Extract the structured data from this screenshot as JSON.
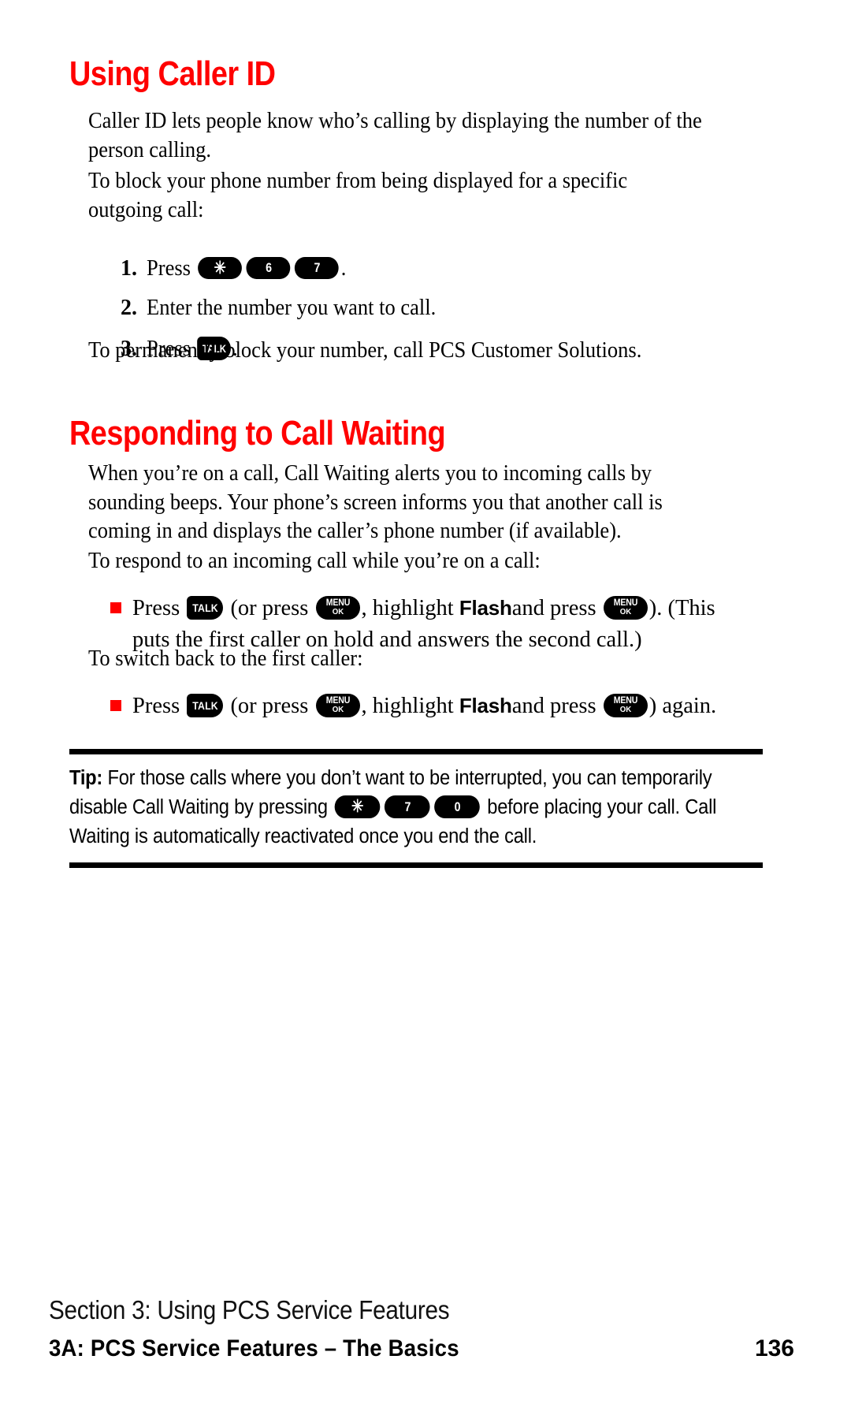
{
  "page": {
    "background_color": "#ffffff",
    "accent_color": "#ff0000",
    "text_color": "#000000"
  },
  "headings": {
    "caller_id": "Using Caller ID",
    "call_waiting": "Responding to Call Waiting"
  },
  "paragraphs": {
    "caller_id_intro": "Caller ID lets people know who’s calling by displaying the number of the person calling.",
    "block_intro": "To block your phone number from being displayed for a specific outgoing call:",
    "permanently_block": "To permanently block your number, call PCS Customer Solutions.",
    "call_waiting_intro": "When you’re on a call, Call Waiting alerts you to incoming calls by sounding beeps. Your phone’s screen informs you that another call is coming in and displays the caller’s phone number (if available).",
    "respond_intro": "To respond to an incoming call while you’re on a call:",
    "switch_back_intro": "To switch back to the first caller:"
  },
  "steps": [
    {
      "number": "1.",
      "before_keys": "Press",
      "keys": [
        "star",
        "6",
        "7"
      ],
      "after_keys": "."
    },
    {
      "number": "2.",
      "text": "Enter the number you want to call."
    },
    {
      "number": "3.",
      "before_keys": "Press",
      "keys": [
        "talk"
      ],
      "after_keys": "."
    }
  ],
  "bullets": [
    {
      "t1": "Press",
      "t2": "(or press",
      "t3": ", highlight",
      "emphasis": "Flash",
      "t4": "and press",
      "t5": "). (This",
      "line2": "puts the first caller on hold and answers the second call.)"
    },
    {
      "t1": "Press",
      "t2": "(or press",
      "t3": ", highlight",
      "emphasis": "Flash",
      "t4": "and press",
      "t5": ") again.",
      "line2": ""
    }
  ],
  "keys": {
    "star_glyph": "✳",
    "six": "6",
    "seven": "7",
    "zero": "0",
    "talk": "TALK",
    "menu_line1": "MENU",
    "menu_line2": "OK"
  },
  "tip": {
    "label": "Tip:",
    "text_before_keys": "For those calls where you don’t want to be interrupted, you can temporarily disable Call Waiting by pressing",
    "keys": [
      "star",
      "7",
      "0"
    ],
    "text_after_keys": "before placing your call. Call Waiting is automatically reactivated once you end the call."
  },
  "footer": {
    "section": "Section 3: Using PCS Service Features",
    "chapter": "3A: PCS Service Features – The Basics",
    "page_number": "136"
  }
}
